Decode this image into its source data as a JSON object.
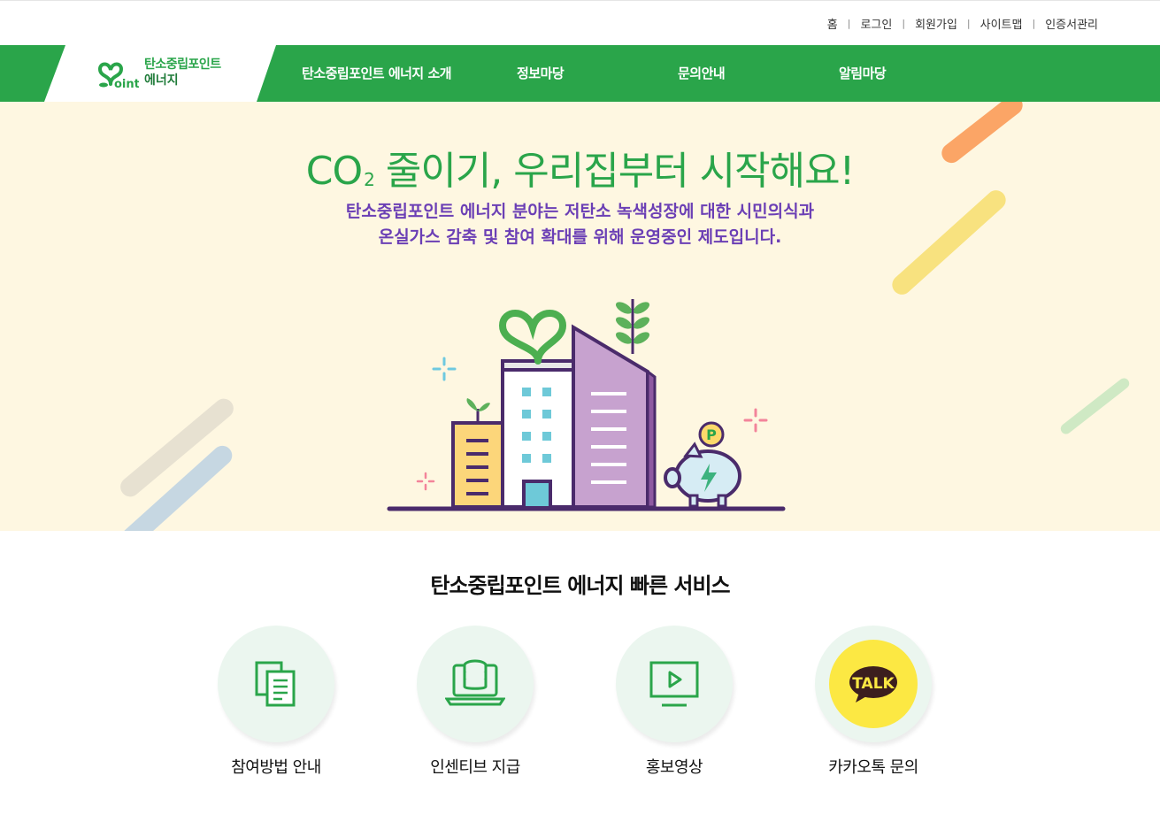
{
  "util_links": [
    "홈",
    "로그인",
    "회원가입",
    "사이트맵",
    "인증서관리"
  ],
  "logo": {
    "line1": "탄소중립포인트",
    "line2": "에너지",
    "mark_text": "oint"
  },
  "nav": {
    "items": [
      "탄소중립포인트 에너지 소개",
      "정보마당",
      "문의안내",
      "알림마당"
    ]
  },
  "hero": {
    "title_co": "CO",
    "title_sub": "2",
    "title_rest": " 줄이기, 우리집부터 시작해요!",
    "desc_line1": "탄소중립포인트 에너지 분야는 저탄소 녹색성장에 대한 시민의식과",
    "desc_line2": "온실가스 감축 및 참여 확대를 위해 운영중인 제도입니다.",
    "coin_label": "P"
  },
  "services": {
    "title": "탄소중립포인트 에너지 빠른 서비스",
    "items": [
      {
        "label": "참여방법 안내",
        "icon": "document-copy-icon"
      },
      {
        "label": "인센티브 지급",
        "icon": "coins-laptop-icon"
      },
      {
        "label": "홍보영상",
        "icon": "video-play-icon"
      },
      {
        "label": "카카오톡 문의",
        "icon": "kakaotalk-icon",
        "badge": "TALK"
      }
    ]
  },
  "colors": {
    "brand_green": "#2aa54a",
    "hero_bg": "#fef7e1",
    "desc_purple": "#6b3fb5",
    "kakao_yellow": "#fce843"
  }
}
